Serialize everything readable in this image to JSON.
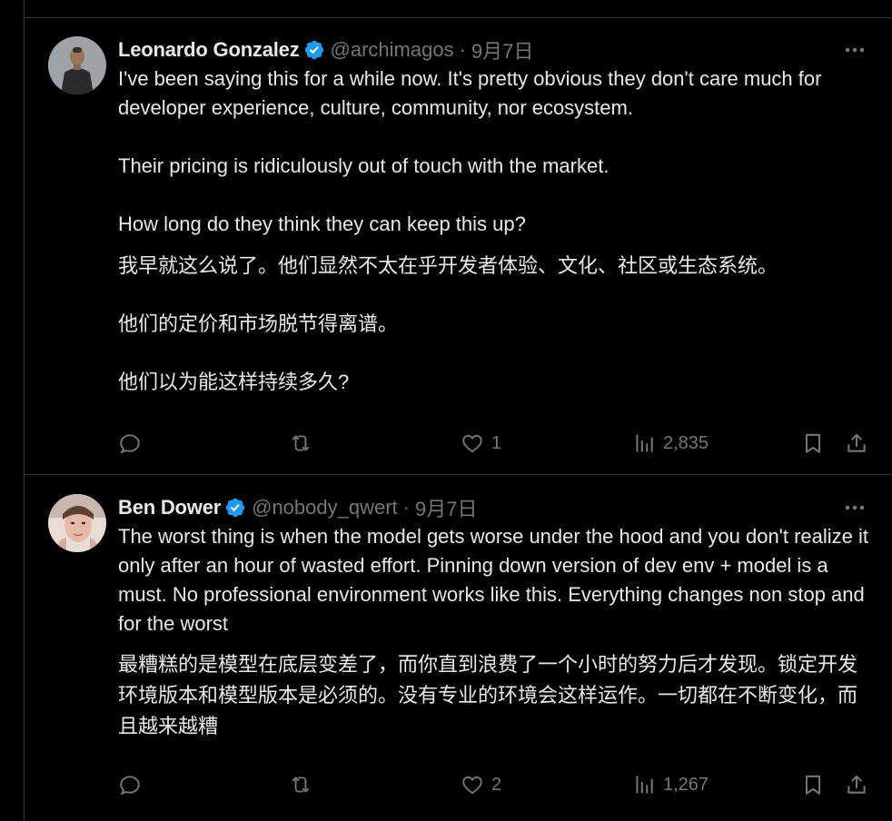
{
  "tweets": [
    {
      "name": "Leonardo Gonzalez",
      "handle": "@archimagos",
      "separator": "·",
      "date": "9月7日",
      "paragraphs": [
        "I've been saying this for a while now. It's pretty obvious they don't care much for developer experience, culture, community, nor ecosystem.",
        "Their pricing is ridiculously out of touch with the market.",
        "How long do they think they can keep this up?"
      ],
      "translation": [
        "我早就这么说了。他们显然不太在乎开发者体验、文化、社区或生态系统。",
        "他们的定价和市场脱节得离谱。",
        "他们以为能这样持续多久?"
      ],
      "likes": "1",
      "views": "2,835",
      "replies": "",
      "reposts": ""
    },
    {
      "name": "Ben Dower",
      "handle": "@nobody_qwert",
      "separator": "·",
      "date": "9月7日",
      "paragraphs": [
        "The worst thing is when the model gets worse under the hood and you don't realize it only after an hour of wasted effort. Pinning down version of dev env + model is  a must. No professional environment works like this. Everything changes non stop and for the worst"
      ],
      "translation": [
        "最糟糕的是模型在底层变差了，而你直到浪费了一个小时的努力后才发现。锁定开发环境版本和模型版本是必须的。没有专业的环境会这样运作。一切都在不断变化，而且越来越糟"
      ],
      "likes": "2",
      "views": "1,267",
      "replies": "",
      "reposts": ""
    }
  ],
  "colors": {
    "background": "#000000",
    "text": "#e7e9ea",
    "muted": "#71767b",
    "verified": "#1d9bf0",
    "border": "#2f3336"
  },
  "icons": [
    "verified-badge-icon",
    "more-icon",
    "reply-icon",
    "repost-icon",
    "like-icon",
    "views-icon",
    "bookmark-icon",
    "share-icon"
  ]
}
